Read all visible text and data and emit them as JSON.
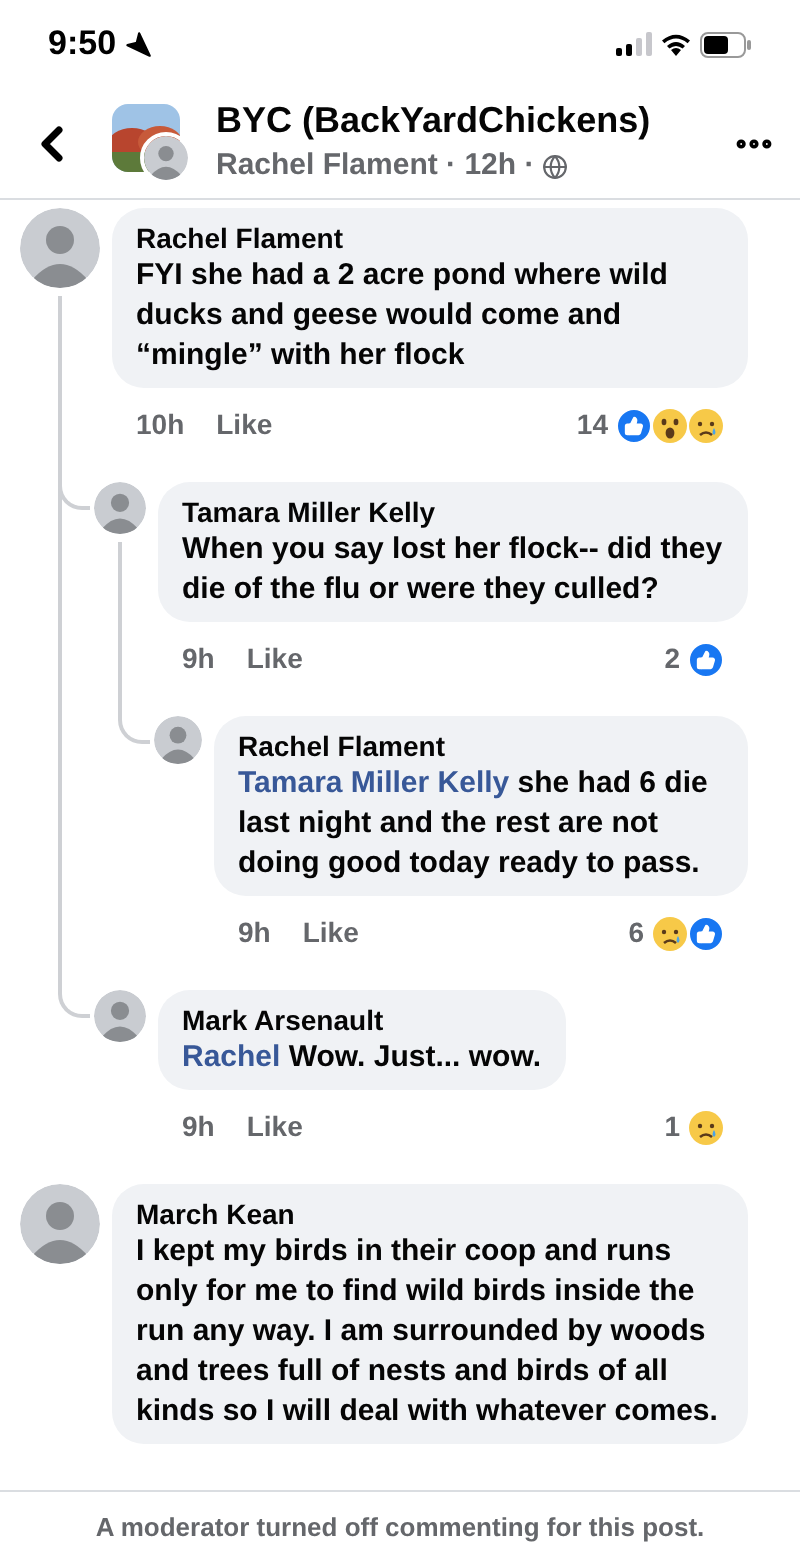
{
  "status_bar": {
    "time": "9:50"
  },
  "header": {
    "group": "BYC (BackYardChickens)",
    "byline": "Rachel Flament · 12h ·"
  },
  "comments": [
    {
      "author": "Rachel Flament",
      "text": "FYI she had a 2 acre pond where wild ducks and geese would come and “mingle” with her flock",
      "time": "10h",
      "action": "Like",
      "reaction_count": "14",
      "reactions": [
        {
          "kind": "like"
        },
        {
          "kind": "wow"
        },
        {
          "kind": "sad"
        }
      ],
      "children": [
        {
          "author": "Tamara Miller Kelly",
          "text": "When you say lost her flock-- did they die of the flu or were they culled?",
          "time": "9h",
          "action": "Like",
          "reaction_count": "2",
          "reactions": [
            {
              "kind": "like"
            }
          ],
          "children": [
            {
              "author": "Rachel Flament",
              "mention": "Tamara Miller Kelly",
              "text": "she had 6 die last night and the rest are not doing good today ready to pass.",
              "time": "9h",
              "action": "Like",
              "reaction_count": "6",
              "reactions": [
                {
                  "kind": "sad"
                },
                {
                  "kind": "like"
                }
              ]
            }
          ]
        },
        {
          "author": "Mark Arsenault",
          "mention": "Rachel",
          "text": "Wow. Just... wow.",
          "time": "9h",
          "action": "Like",
          "reaction_count": "1",
          "reactions": [
            {
              "kind": "sad"
            }
          ]
        }
      ]
    },
    {
      "author": "March Kean",
      "text": "I kept my birds in their coop and runs only for me to find wild birds inside the run any way.  I am surrounded by woods and trees full of nests and birds of all kinds so I will deal with whatever comes."
    }
  ],
  "footer": {
    "notice": "A moderator turned off commenting for this post."
  }
}
